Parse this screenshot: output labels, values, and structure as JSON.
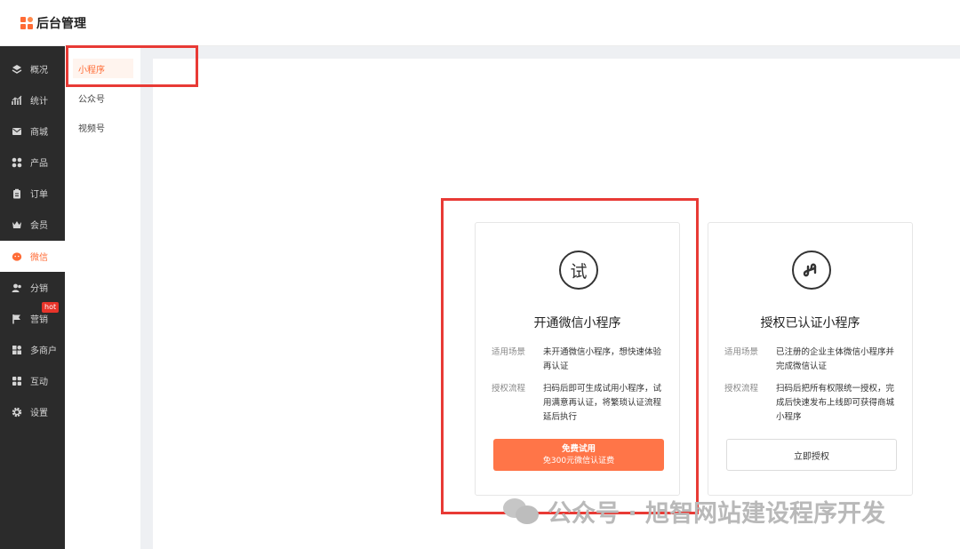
{
  "header": {
    "title": "后台管理"
  },
  "sidebar": {
    "items": [
      {
        "label": "概况",
        "icon": "layers-icon"
      },
      {
        "label": "统计",
        "icon": "chart-icon"
      },
      {
        "label": "商城",
        "icon": "mail-icon"
      },
      {
        "label": "产品",
        "icon": "grid-icon"
      },
      {
        "label": "订单",
        "icon": "clipboard-icon"
      },
      {
        "label": "会员",
        "icon": "crown-icon"
      },
      {
        "label": "微信",
        "icon": "wechat-icon",
        "active": true
      },
      {
        "label": "分销",
        "icon": "users-icon"
      },
      {
        "label": "营销",
        "icon": "flag-icon",
        "badge": "hot"
      },
      {
        "label": "多商户",
        "icon": "store-icon"
      },
      {
        "label": "互动",
        "icon": "apps-icon"
      },
      {
        "label": "设置",
        "icon": "gear-icon"
      }
    ]
  },
  "subnav": {
    "items": [
      {
        "label": "小程序",
        "active": true
      },
      {
        "label": "公众号"
      },
      {
        "label": "视频号"
      }
    ]
  },
  "cards": [
    {
      "icon_text": "试",
      "title": "开通微信小程序",
      "rows": [
        {
          "label": "适用场景",
          "value": "未开通微信小程序，想快速体验再认证"
        },
        {
          "label": "授权流程",
          "value": "扫码后即可生成试用小程序，试用满意再认证，将繁琐认证流程延后执行"
        }
      ],
      "button_line1": "免费试用",
      "button_line2": "免300元微信认证费"
    },
    {
      "icon": "mini-program-icon",
      "title": "授权已认证小程序",
      "rows": [
        {
          "label": "适用场景",
          "value": "已注册的企业主体微信小程序并完成微信认证"
        },
        {
          "label": "授权流程",
          "value": "扫码后把所有权限统一授权，完成后快速发布上线即可获得商城小程序"
        }
      ],
      "button": "立即授权"
    }
  ],
  "watermark": {
    "text": "公众号 · 旭智网站建设程序开发"
  },
  "colors": {
    "accent": "#ff6b35",
    "sidebar_bg": "#2b2b2b",
    "highlight": "#e83a35",
    "button_primary": "#ff7548"
  }
}
